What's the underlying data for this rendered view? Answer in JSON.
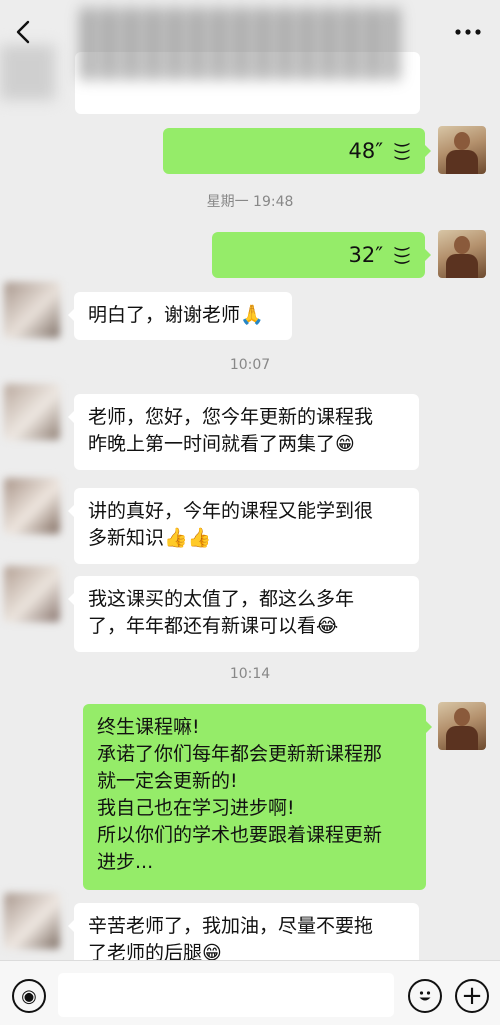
{
  "messages": {
    "m1": {
      "duration": "48″"
    },
    "t1": "星期一 19:48",
    "m2": {
      "duration": "32″"
    },
    "m3": {
      "text": "明白了，谢谢老师🙏"
    },
    "t2": "10:07",
    "m4": {
      "line1": "老师，您好，您今年更新的课程我",
      "line2": "昨晚上第一时间就看了两集了",
      "emoji": "😁"
    },
    "m5": {
      "line1": "讲的真好，今年的课程又能学到很",
      "line2": "多新知识",
      "emoji": "👍👍"
    },
    "m6": {
      "line1": "我这课买的太值了，都这么多年",
      "line2": "了，年年都还有新课可以看",
      "emoji": "😂"
    },
    "t3": "10:14",
    "m7": {
      "line1": "终生课程嘛!",
      "line2": "承诺了你们每年都会更新新课程那",
      "line3": "就一定会更新的!",
      "line4": "我自己也在学习进步啊!",
      "line5": "所以你们的学术也要跟着课程更新",
      "line6": "进步..."
    },
    "m8": {
      "line1": "辛苦老师了，我加油，尽量不要拖",
      "line2": "了老师的后腿",
      "emoji": "😁"
    }
  },
  "icons": {
    "back": "chevron-left-icon",
    "more": "more-icon",
    "voice_toggle": "voice-mode-icon",
    "emoji": "emoji-icon",
    "plus": "plus-icon"
  },
  "colors": {
    "background": "#ededed",
    "bubble_self": "#95ec69",
    "bubble_other": "#ffffff",
    "timestamp": "#888888"
  }
}
